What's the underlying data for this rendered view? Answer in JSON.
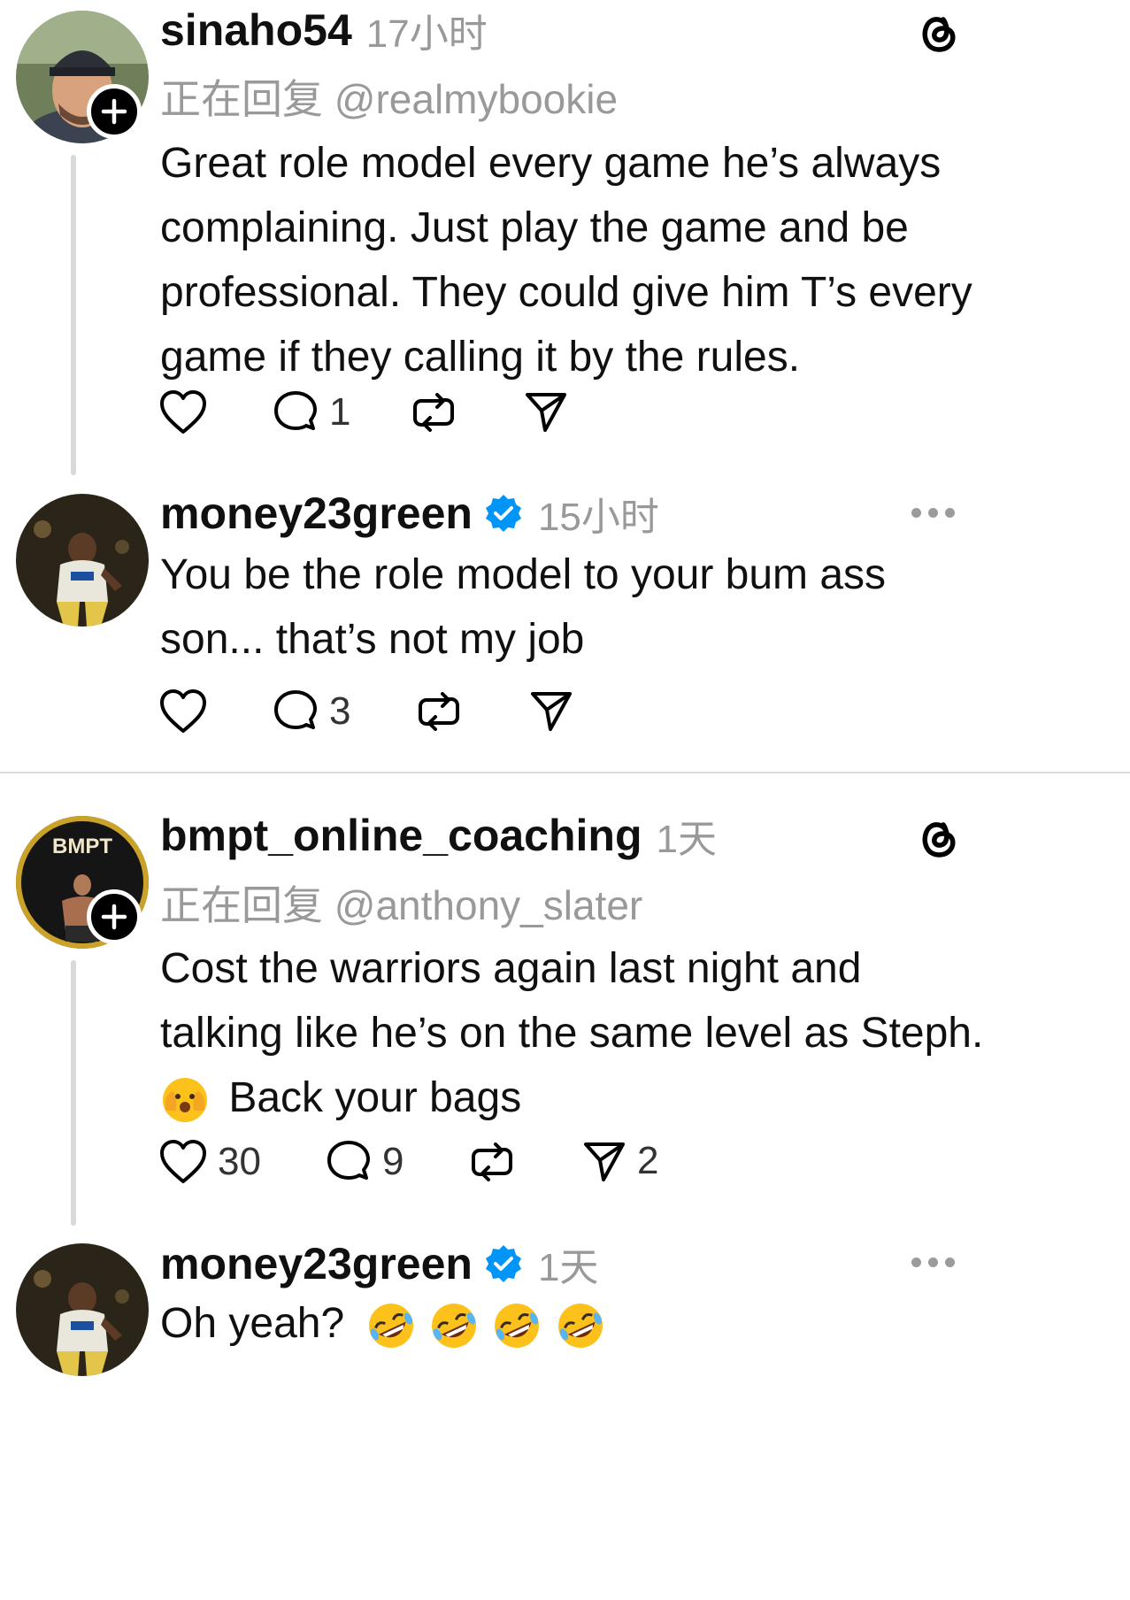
{
  "posts": [
    {
      "username": "sinaho54",
      "time": "17小时",
      "reply_to": "正在回复 @realmybookie",
      "lines": [
        "Great role model every game he’s always",
        "complaining.  Just play the game and be",
        "professional.  They could give him T’s every",
        "game if they calling it by the rules."
      ],
      "likes": "",
      "comments": "1",
      "reposts": "",
      "shares": ""
    },
    {
      "username": "money23green",
      "time": "15小时",
      "lines": [
        "You be the role model to your bum ass",
        "son... that’s not my job"
      ],
      "likes": "",
      "comments": "3",
      "reposts": "",
      "shares": ""
    },
    {
      "username": "bmpt_online_coaching",
      "time": "1天",
      "reply_to": "正在回复 @anthony_slater",
      "avatar_text": "BMPT",
      "lines": [
        "Cost the warriors again last night and",
        "talking like he’s on the same level as Steph."
      ],
      "line3_text": "Back your bags",
      "likes": "30",
      "comments": "9",
      "reposts": "",
      "shares": "2"
    },
    {
      "username": "money23green",
      "time": "1天",
      "text": "Oh yeah?"
    }
  ],
  "colors": {
    "verified_blue": "#0095f6",
    "secondary_text": "#999999",
    "primary_text": "#101010",
    "thread_line": "#d9d9d9"
  },
  "icons": [
    "threads-logo-icon",
    "heart-icon",
    "comment-icon",
    "repost-icon",
    "share-icon",
    "verified-badge-icon",
    "more-options-icon",
    "follow-plus-icon"
  ]
}
